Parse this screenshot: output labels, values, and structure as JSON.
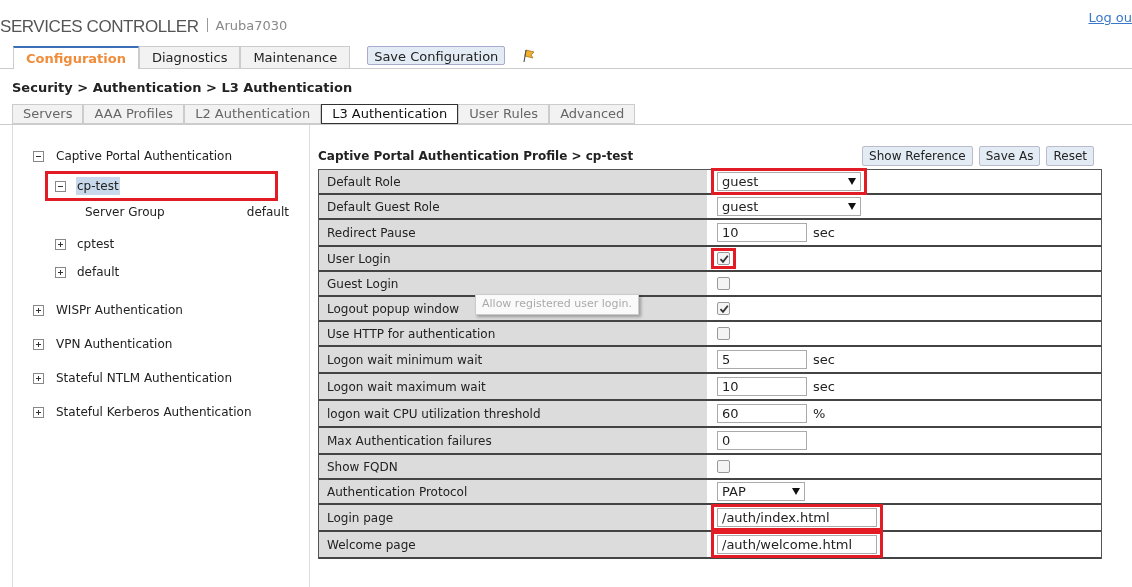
{
  "header": {
    "title": "SERVICES CONTROLLER",
    "device": "Aruba7030",
    "logout": "Log ou"
  },
  "main_tabs": [
    {
      "label": "Configuration",
      "selected": true
    },
    {
      "label": "Diagnostics",
      "selected": false
    },
    {
      "label": "Maintenance",
      "selected": false
    }
  ],
  "save_button": "Save Configuration",
  "breadcrumb": "Security > Authentication > L3 Authentication",
  "sub_tabs": [
    {
      "label": "Servers",
      "selected": false
    },
    {
      "label": "AAA Profiles",
      "selected": false
    },
    {
      "label": "L2 Authentication",
      "selected": false
    },
    {
      "label": "L3 Authentication",
      "selected": true
    },
    {
      "label": "User Rules",
      "selected": false
    },
    {
      "label": "Advanced",
      "selected": false
    }
  ],
  "tree": [
    {
      "label": "Captive Portal Authentication",
      "expanded": true,
      "children": [
        {
          "label": "cp-test",
          "expanded": true,
          "selected": true,
          "highlighted": true,
          "detail": {
            "name": "Server Group",
            "value": "default"
          }
        },
        {
          "label": "cptest",
          "expanded": false,
          "selected": false,
          "highlighted": false
        },
        {
          "label": "default",
          "expanded": false,
          "selected": false,
          "highlighted": false
        }
      ]
    },
    {
      "label": "WISPr Authentication",
      "expanded": false
    },
    {
      "label": "VPN Authentication",
      "expanded": false
    },
    {
      "label": "Stateful NTLM Authentication",
      "expanded": false
    },
    {
      "label": "Stateful Kerberos Authentication",
      "expanded": false
    }
  ],
  "profile": {
    "title": "Captive Portal Authentication Profile > cp-test",
    "buttons": [
      "Show Reference",
      "Save As",
      "Reset"
    ],
    "rows": [
      {
        "label": "Default Role",
        "kind": "select",
        "value": "guest",
        "highlighted": true
      },
      {
        "label": "Default Guest Role",
        "kind": "select",
        "value": "guest",
        "highlighted": false
      },
      {
        "label": "Redirect Pause",
        "kind": "text",
        "value": "10",
        "unit": "sec",
        "highlighted": false
      },
      {
        "label": "User Login",
        "kind": "checkbox",
        "checked": true,
        "highlighted": true
      },
      {
        "label": "Guest Login",
        "kind": "checkbox",
        "checked": false,
        "highlighted": false
      },
      {
        "label": "Logout popup window",
        "kind": "checkbox",
        "checked": true,
        "highlighted": false
      },
      {
        "label": "Use HTTP for authentication",
        "kind": "checkbox",
        "checked": false,
        "highlighted": false
      },
      {
        "label": "Logon wait minimum wait",
        "kind": "text",
        "value": "5",
        "unit": "sec",
        "highlighted": false
      },
      {
        "label": "Logon wait maximum wait",
        "kind": "text",
        "value": "10",
        "unit": "sec",
        "highlighted": false
      },
      {
        "label": "logon wait CPU utilization threshold",
        "kind": "text",
        "value": "60",
        "unit": "%",
        "highlighted": false
      },
      {
        "label": "Max Authentication failures",
        "kind": "text",
        "value": "0",
        "highlighted": false
      },
      {
        "label": "Show FQDN",
        "kind": "checkbox",
        "checked": false,
        "highlighted": false
      },
      {
        "label": "Authentication Protocol",
        "kind": "select",
        "value": "PAP",
        "short": true,
        "highlighted": false
      },
      {
        "label": "Login page",
        "kind": "text",
        "value": "/auth/index.html",
        "wide": true,
        "highlighted": true
      },
      {
        "label": "Welcome page",
        "kind": "text",
        "value": "/auth/welcome.html",
        "wide": true,
        "highlighted": true
      }
    ]
  },
  "tooltip": "Allow registered user login."
}
